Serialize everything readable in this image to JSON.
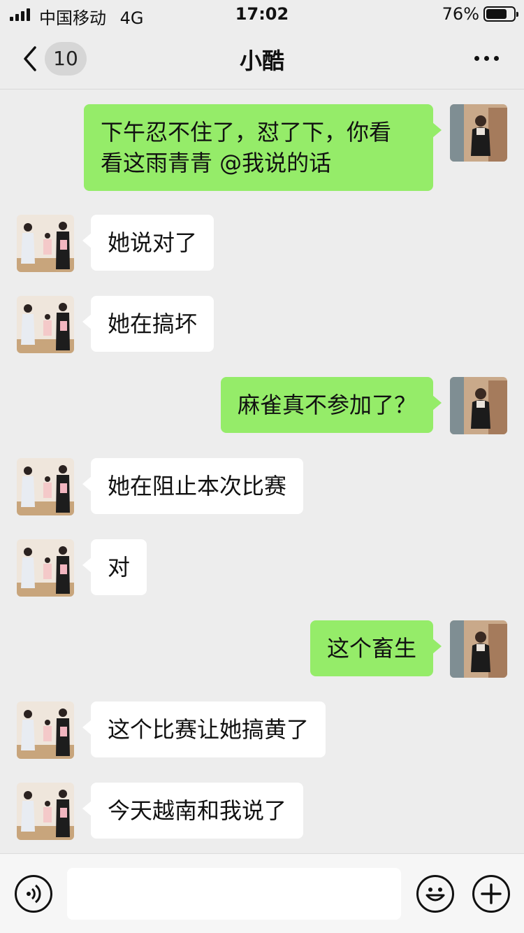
{
  "status_bar": {
    "carrier": "中国移动",
    "network": "4G",
    "time": "17:02",
    "battery_percent": "76%",
    "battery_level": 0.76
  },
  "nav": {
    "back_icon": "chevron-left-icon",
    "unread_count": "10",
    "title": "小酷",
    "more_icon": "ellipsis-icon"
  },
  "messages": [
    {
      "sender": "me",
      "lines": [
        "下午忍不住了，怼了下，你看",
        "看这雨青青 @我说的话"
      ]
    },
    {
      "sender": "other",
      "lines": [
        "她说对了"
      ]
    },
    {
      "sender": "other",
      "lines": [
        "她在搞坏"
      ]
    },
    {
      "sender": "me",
      "lines": [
        "麻雀真不参加了？"
      ]
    },
    {
      "sender": "other",
      "lines": [
        "她在阻止本次比赛"
      ]
    },
    {
      "sender": "other",
      "lines": [
        "对"
      ]
    },
    {
      "sender": "me",
      "lines": [
        "这个畜生"
      ]
    },
    {
      "sender": "other",
      "lines": [
        "这个比赛让她搞黄了"
      ]
    },
    {
      "sender": "other",
      "lines": [
        "今天越南和我说了"
      ]
    }
  ],
  "input_bar": {
    "voice_icon": "voice-icon",
    "text_value": "",
    "emoji_icon": "emoji-icon",
    "plus_icon": "plus-icon"
  },
  "colors": {
    "bubble_me": "#95ec69",
    "bubble_other": "#ffffff",
    "background": "#ededed"
  }
}
